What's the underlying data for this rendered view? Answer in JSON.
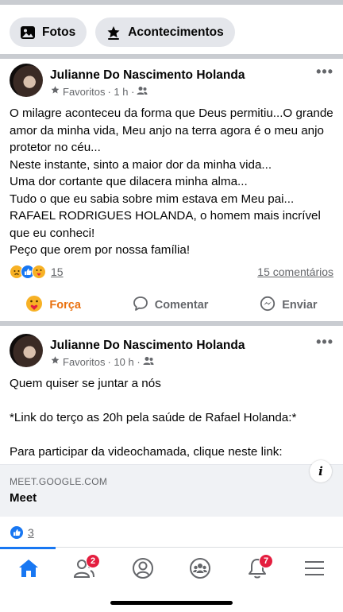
{
  "filters": {
    "photos_label": "Fotos",
    "events_label": "Acontecimentos"
  },
  "post1": {
    "author": "Julianne Do Nascimento Holanda",
    "audience": "Favoritos",
    "time": "· 1 h ·",
    "text": "O milagre aconteceu da forma que Deus permitiu...O grande amor da minha vida, Meu anjo na terra agora é o meu anjo protetor no céu...\nNeste instante, sinto a maior dor da minha vida...\nUma dor cortante que dilacera minha alma...\nTudo o que eu sabia sobre mim estava em Meu pai...\nRAFAEL RODRIGUES HOLANDA, o homem mais incrível que eu conheci!\nPeço que orem por nossa família!",
    "reaction_count": "15",
    "comments": "15 comentários",
    "action_care": "Força",
    "action_comment": "Comentar",
    "action_send": "Enviar"
  },
  "post2": {
    "author": "Julianne Do Nascimento Holanda",
    "audience": "Favoritos",
    "time": "· 10 h ·",
    "text": "Quem quiser se juntar a nós\n\n*Link do terço as 20h pela saúde de Rafael Holanda:*\n\nPara participar da videochamada, clique neste link:",
    "link_domain": "MEET.GOOGLE.COM",
    "link_title": "Meet",
    "reaction_count": "3"
  },
  "tabbar": {
    "friends_badge": "2",
    "notifications_badge": "7"
  },
  "colors": {
    "accent": "#1877f2",
    "care": "#e9710f",
    "badge": "#e41e3f"
  }
}
